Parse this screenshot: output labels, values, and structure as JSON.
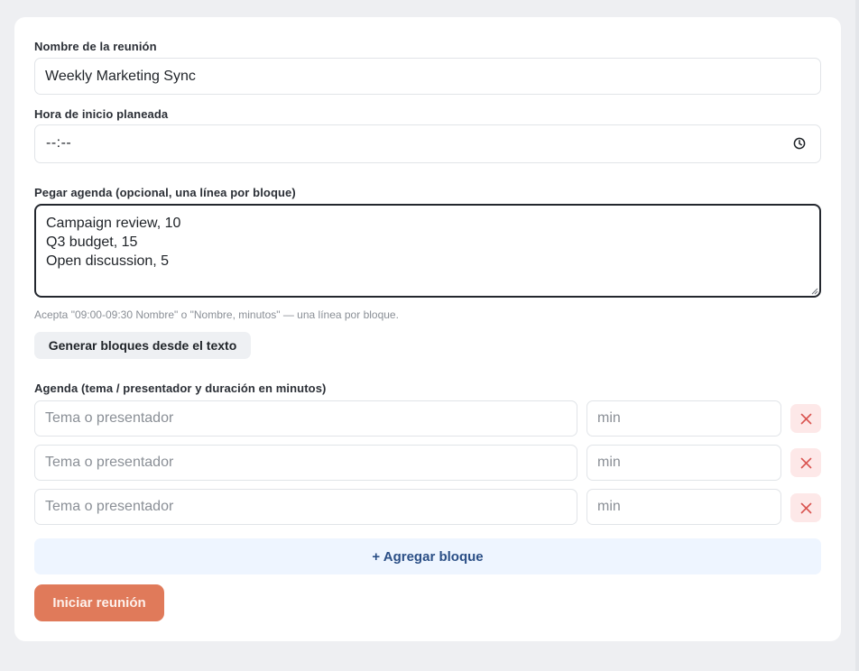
{
  "form": {
    "meeting_name_label": "Nombre de la reunión",
    "meeting_name_value": "Weekly Marketing Sync",
    "start_time_label": "Hora de inicio planeada",
    "start_time_value": "--:--",
    "paste_agenda_label": "Pegar agenda (opcional, una línea por bloque)",
    "paste_agenda_value": "Campaign review, 10\nQ3 budget, 15\nOpen discussion, 5",
    "paste_hint": "Acepta \"09:00-09:30 Nombre\" o \"Nombre, minutos\" — una línea por bloque.",
    "generate_button": "Generar bloques desde el texto",
    "agenda_label": "Agenda (tema / presentador y duración en minutos)",
    "topic_placeholder": "Tema o presentador",
    "minutes_placeholder": "min",
    "blocks": [
      {
        "topic": "",
        "minutes": ""
      },
      {
        "topic": "",
        "minutes": ""
      },
      {
        "topic": "",
        "minutes": ""
      }
    ],
    "add_block_button": "+ Agregar bloque",
    "start_button": "Iniciar reunión"
  },
  "icons": {
    "time": "clock-icon",
    "remove": "close-icon",
    "resize": "resize-grip-icon"
  },
  "colors": {
    "page_bg": "#eeeff2",
    "card_bg": "#ffffff",
    "start_button": "#e07a5a",
    "add_button_bg": "#eef5ff",
    "add_button_text": "#2b4f86",
    "delete_bg": "#fde8e8",
    "delete_icon": "#d9534f"
  }
}
